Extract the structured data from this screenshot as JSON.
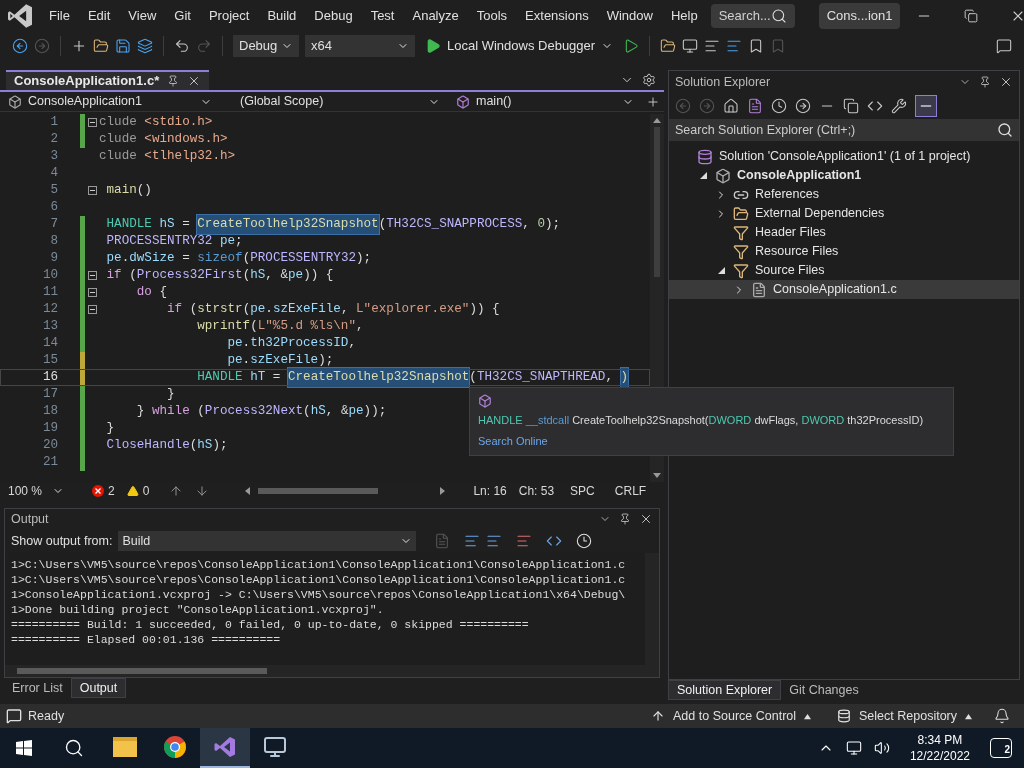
{
  "menu_bar": {
    "items": [
      "File",
      "Edit",
      "View",
      "Git",
      "Project",
      "Build",
      "Debug",
      "Test",
      "Analyze",
      "Tools",
      "Extensions",
      "Window",
      "Help"
    ],
    "search_placeholder": "Search...",
    "solution_name": "Cons...ion1"
  },
  "toolbar": {
    "configuration": "Debug",
    "platform": "x64",
    "debugger": "Local Windows Debugger"
  },
  "editor": {
    "tab": {
      "title": "ConsoleApplication1.c*",
      "selected": true
    },
    "nav": {
      "project": "ConsoleApplication1",
      "scope": "(Global Scope)",
      "member": "main()"
    },
    "lines": [
      {
        "number": "1",
        "kind": "saved",
        "fold": true,
        "current": false,
        "tokens": [
          {
            "text": "clude ",
            "kind": "preproc"
          },
          {
            "text": "<stdio.h>",
            "kind": "include"
          }
        ]
      },
      {
        "number": "2",
        "kind": "saved",
        "fold": false,
        "current": false,
        "tokens": [
          {
            "text": "clude ",
            "kind": "preproc"
          },
          {
            "text": "<windows.h>",
            "kind": "include"
          }
        ]
      },
      {
        "number": "3",
        "kind": "unchanged",
        "fold": false,
        "current": false,
        "tokens": [
          {
            "text": "clude ",
            "kind": "preproc"
          },
          {
            "text": "<tlhelp32.h>",
            "kind": "include"
          }
        ]
      },
      {
        "number": "4",
        "kind": "unchanged",
        "fold": false,
        "current": false
      },
      {
        "number": "5",
        "kind": "unchanged",
        "fold": true,
        "current": false,
        "tokens": [
          {
            "text": " main",
            "kind": "func"
          },
          {
            "text": "()",
            "kind": "plain"
          }
        ]
      },
      {
        "number": "6",
        "kind": "unchanged",
        "fold": false,
        "current": false
      },
      {
        "number": "7",
        "kind": "saved",
        "fold": false,
        "current": false,
        "tokens": [
          {
            "text": " HANDLE ",
            "kind": "type"
          },
          {
            "text": "hS",
            "kind": "var"
          },
          {
            "text": " = ",
            "kind": "plain"
          },
          {
            "text": "CreateToolhelp32Snapshot",
            "kind": "match"
          },
          {
            "text": "(",
            "kind": "plain"
          },
          {
            "text": "TH32CS_SNAPPROCESS",
            "kind": "macro"
          },
          {
            "text": ", ",
            "kind": "plain"
          },
          {
            "text": "0",
            "kind": "number"
          },
          {
            "text": ");",
            "kind": "plain"
          }
        ]
      },
      {
        "number": "8",
        "kind": "saved",
        "fold": false,
        "current": false,
        "tokens": [
          {
            "text": " PROCESSENTRY32 ",
            "kind": "macro"
          },
          {
            "text": "pe",
            "kind": "var"
          },
          {
            "text": ";",
            "kind": "plain"
          }
        ]
      },
      {
        "number": "9",
        "kind": "saved",
        "fold": false,
        "current": false,
        "tokens": [
          {
            "text": " pe",
            "kind": "var"
          },
          {
            "text": ".",
            "kind": "plain"
          },
          {
            "text": "dwSize",
            "kind": "var"
          },
          {
            "text": " = ",
            "kind": "plain"
          },
          {
            "text": "sizeof",
            "kind": "keyword"
          },
          {
            "text": "(",
            "kind": "plain"
          },
          {
            "text": "PROCESSENTRY32",
            "kind": "macro"
          },
          {
            "text": ");",
            "kind": "plain"
          }
        ]
      },
      {
        "number": "10",
        "kind": "saved",
        "fold": true,
        "current": false,
        "tokens": [
          {
            "text": " if",
            "kind": "control"
          },
          {
            "text": " (",
            "kind": "plain"
          },
          {
            "text": "Process32First",
            "kind": "macro"
          },
          {
            "text": "(",
            "kind": "plain"
          },
          {
            "text": "hS",
            "kind": "var"
          },
          {
            "text": ", &",
            "kind": "plain"
          },
          {
            "text": "pe",
            "kind": "var"
          },
          {
            "text": ")) {",
            "kind": "plain"
          }
        ]
      },
      {
        "number": "11",
        "kind": "saved",
        "fold": true,
        "current": false,
        "tokens": [
          {
            "text": "     do",
            "kind": "control"
          },
          {
            "text": " {",
            "kind": "plain"
          }
        ]
      },
      {
        "number": "12",
        "kind": "saved",
        "fold": true,
        "current": false,
        "tokens": [
          {
            "text": "         if",
            "kind": "control"
          },
          {
            "text": " (",
            "kind": "plain"
          },
          {
            "text": "strstr",
            "kind": "func"
          },
          {
            "text": "(",
            "kind": "plain"
          },
          {
            "text": "pe",
            "kind": "var"
          },
          {
            "text": ".",
            "kind": "plain"
          },
          {
            "text": "szExeFile",
            "kind": "var"
          },
          {
            "text": ", ",
            "kind": "plain"
          },
          {
            "text": "L\"explorer.exe\"",
            "kind": "string"
          },
          {
            "text": ")) {",
            "kind": "plain"
          }
        ]
      },
      {
        "number": "13",
        "kind": "saved",
        "fold": false,
        "current": false,
        "tokens": [
          {
            "text": "             wprintf",
            "kind": "func"
          },
          {
            "text": "(",
            "kind": "plain"
          },
          {
            "text": "L\"%5.d %ls\\n\"",
            "kind": "string"
          },
          {
            "text": ",",
            "kind": "plain"
          }
        ]
      },
      {
        "number": "14",
        "kind": "saved",
        "fold": false,
        "current": false,
        "tokens": [
          {
            "text": "                 pe",
            "kind": "var"
          },
          {
            "text": ".",
            "kind": "plain"
          },
          {
            "text": "th32ProcessID",
            "kind": "var"
          },
          {
            "text": ",",
            "kind": "plain"
          }
        ]
      },
      {
        "number": "15",
        "kind": "unsaved",
        "fold": false,
        "current": false,
        "tokens": [
          {
            "text": "                 pe",
            "kind": "var"
          },
          {
            "text": ".",
            "kind": "plain"
          },
          {
            "text": "szExeFile",
            "kind": "var"
          },
          {
            "text": ");",
            "kind": "plain"
          }
        ]
      },
      {
        "number": "16",
        "kind": "unsaved",
        "fold": false,
        "current": true,
        "tokens": [
          {
            "text": "             HANDLE ",
            "kind": "type"
          },
          {
            "text": "hT",
            "kind": "var"
          },
          {
            "text": " = ",
            "kind": "plain"
          },
          {
            "text": "CreateToolhelp32Snapshot",
            "kind": "match"
          },
          {
            "text": "(",
            "kind": "plain"
          },
          {
            "text": "TH32CS_SNAPTHREAD",
            "kind": "macro"
          },
          {
            "text": ", ",
            "kind": "plain"
          },
          {
            "text": ")",
            "kind": "match"
          }
        ]
      },
      {
        "number": "17",
        "kind": "saved",
        "fold": false,
        "current": false,
        "tokens": [
          {
            "text": "         }",
            "kind": "plain"
          }
        ]
      },
      {
        "number": "18",
        "kind": "saved",
        "fold": false,
        "current": false,
        "tokens": [
          {
            "text": "     }",
            "kind": "plain"
          },
          {
            "text": " while",
            "kind": "control"
          },
          {
            "text": " (",
            "kind": "plain"
          },
          {
            "text": "Process32Next",
            "kind": "macro"
          },
          {
            "text": "(",
            "kind": "plain"
          },
          {
            "text": "hS",
            "kind": "var"
          },
          {
            "text": ", &",
            "kind": "plain"
          },
          {
            "text": "pe",
            "kind": "var"
          },
          {
            "text": "));",
            "kind": "plain"
          }
        ]
      },
      {
        "number": "19",
        "kind": "saved",
        "fold": false,
        "current": false,
        "tokens": [
          {
            "text": " }",
            "kind": "plain"
          }
        ]
      },
      {
        "number": "20",
        "kind": "saved",
        "fold": false,
        "current": false,
        "tokens": [
          {
            "text": " CloseHandle",
            "kind": "macro"
          },
          {
            "text": "(",
            "kind": "plain"
          },
          {
            "text": "hS",
            "kind": "var"
          },
          {
            "text": ");",
            "kind": "plain"
          }
        ]
      },
      {
        "number": "21",
        "kind": "saved",
        "fold": false,
        "current": false
      }
    ],
    "tooltip": {
      "signature": [
        {
          "text": "HANDLE",
          "kind": "type"
        },
        {
          "text": " __stdcall",
          "kind": "keyword"
        },
        {
          "text": " CreateToolhelp32Snapshot(",
          "kind": "plain"
        },
        {
          "text": "DWORD",
          "kind": "type"
        },
        {
          "text": " dwFlags, ",
          "kind": "plain"
        },
        {
          "text": "DWORD",
          "kind": "type"
        },
        {
          "text": " th32ProcessID)",
          "kind": "plain"
        }
      ],
      "link": "Search Online"
    },
    "status": {
      "zoom": "100 %",
      "errors": "2",
      "warnings": "0",
      "line": "Ln: 16",
      "column": "Ch: 53",
      "spacing": "SPC",
      "line_ending": "CRLF"
    }
  },
  "output": {
    "title": "Output",
    "source_label": "Show output from:",
    "source_value": "Build",
    "lines": [
      "1>C:\\Users\\VM5\\source\\repos\\ConsoleApplication1\\ConsoleApplication1\\ConsoleApplication1.c",
      "1>C:\\Users\\VM5\\source\\repos\\ConsoleApplication1\\ConsoleApplication1\\ConsoleApplication1.c",
      "1>ConsoleApplication1.vcxproj -> C:\\Users\\VM5\\source\\repos\\ConsoleApplication1\\x64\\Debug\\",
      "1>Done building project \"ConsoleApplication1.vcxproj\".",
      "========== Build: 1 succeeded, 0 failed, 0 up-to-date, 0 skipped ==========",
      "========== Elapsed 00:01.136 =========="
    ]
  },
  "left_tabs": [
    {
      "label": "Error List",
      "selected": false
    },
    {
      "label": "Output",
      "selected": true
    }
  ],
  "solution_explorer": {
    "title": "Solution Explorer",
    "search_placeholder": "Search Solution Explorer (Ctrl+;)",
    "tree": [
      {
        "label": "Solution 'ConsoleApplication1' (1 of 1 project)",
        "kind": "solution",
        "selected": false,
        "children": [
          {
            "label": "ConsoleApplication1",
            "kind": "project",
            "expanded": true,
            "selected": false,
            "children": [
              {
                "label": "References",
                "kind": "references",
                "expanded": false,
                "selected": false
              },
              {
                "label": "External Dependencies",
                "kind": "dependencies",
                "expanded": false,
                "selected": false
              },
              {
                "label": "Header Files",
                "kind": "filter",
                "selected": false
              },
              {
                "label": "Resource Files",
                "kind": "filter",
                "selected": false
              },
              {
                "label": "Source Files",
                "kind": "filter",
                "expanded": true,
                "selected": false,
                "children": [
                  {
                    "label": "ConsoleApplication1.c",
                    "kind": "file",
                    "expanded": false,
                    "selected": true
                  }
                ]
              }
            ]
          }
        ]
      }
    ]
  },
  "right_tabs": [
    {
      "label": "Solution Explorer",
      "selected": true
    },
    {
      "label": "Git Changes",
      "selected": false
    }
  ],
  "status_bar": {
    "state": "Ready",
    "source_control": "Add to Source Control",
    "repository": "Select Repository"
  },
  "taskbar": {
    "apps": [
      {
        "kind": "explorer",
        "active": false
      },
      {
        "kind": "chrome",
        "active": false
      },
      {
        "kind": "visual-studio",
        "active": true
      },
      {
        "kind": "monitor",
        "active": false
      }
    ],
    "time": "8:34 PM",
    "date": "12/22/2022",
    "notifications": "2"
  }
}
